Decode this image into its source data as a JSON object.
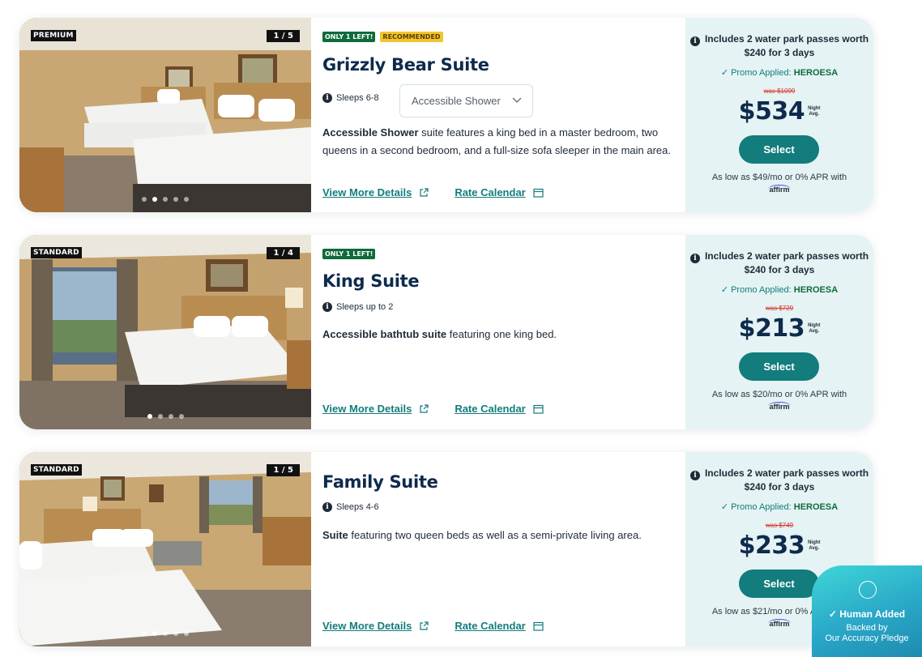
{
  "suites": [
    {
      "photo_tag": "PREMIUM",
      "photo_count": "1 / 5",
      "badges": [
        "ONLY 1 LEFT!",
        "RECOMMENDED"
      ],
      "title": "Grizzly Bear Suite",
      "sleeps": "Sleeps 6-8",
      "option_select": "Accessible Shower",
      "desc_bold": "Accessible Shower",
      "desc_rest": " suite features a king bed in a master bedroom, two queens in a second bedroom, and a full-size sofa sleeper in the main area.",
      "details_link": "View More Details",
      "calendar_link": "Rate Calendar",
      "passes": "Includes 2 water park passes worth $240 for 3 days",
      "promo_prefix": "Promo Applied:",
      "promo_code": "HEROESA",
      "was_price": "was $1099",
      "price": "$534",
      "night_label": "Night",
      "avg_label": "Avg.",
      "select_label": "Select",
      "apr_text": "As low as $49/mo or 0% APR with",
      "affirm_label": "affirm"
    },
    {
      "photo_tag": "STANDARD",
      "photo_count": "1 / 4",
      "badges": [
        "ONLY 1 LEFT!"
      ],
      "title": "King Suite",
      "sleeps": "Sleeps up to 2",
      "desc_bold": "Accessible bathtub suite",
      "desc_rest": " featuring one king bed.",
      "details_link": "View More Details",
      "calendar_link": "Rate Calendar",
      "passes": "Includes 2 water park passes worth $240 for 3 days",
      "promo_prefix": "Promo Applied:",
      "promo_code": "HEROESA",
      "was_price": "was $729",
      "price": "$213",
      "night_label": "Night",
      "avg_label": "Avg.",
      "select_label": "Select",
      "apr_text": "As low as $20/mo or 0% APR with",
      "affirm_label": "affirm"
    },
    {
      "photo_tag": "STANDARD",
      "photo_count": "1 / 5",
      "title": "Family Suite",
      "sleeps": "Sleeps 4-6",
      "desc_bold": "Suite",
      "desc_rest": " featuring two queen beds as well as a semi-private living area.",
      "details_link": "View More Details",
      "calendar_link": "Rate Calendar",
      "passes": "Includes 2 water park passes worth $240 for 3 days",
      "promo_prefix": "Promo Applied:",
      "promo_code": "HEROESA",
      "was_price": "was $749",
      "price": "$233",
      "night_label": "Night",
      "avg_label": "Avg.",
      "select_label": "Select",
      "apr_text": "As low as $21/mo or 0% APR with",
      "affirm_label": "affirm"
    }
  ],
  "pledge": {
    "human_added": "Human Added",
    "backed_by": "Backed by",
    "pledge_text": "Our Accuracy Pledge"
  },
  "colors": {
    "accent": "#137c7c",
    "navy": "#0e2a4d",
    "price_panel": "#e5f3f4",
    "was_price": "#d9332b"
  }
}
